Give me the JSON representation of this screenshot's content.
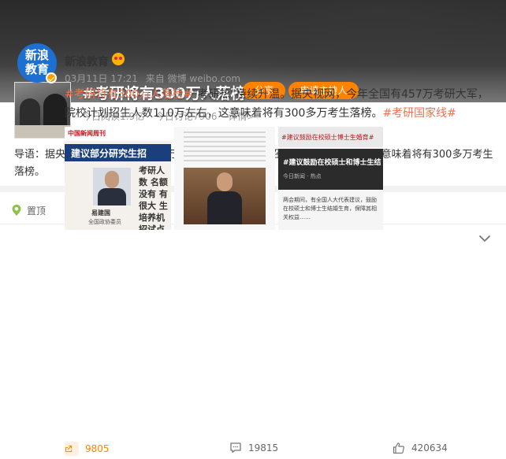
{
  "topic": {
    "title": "#考研将有300万人落榜#",
    "share_label": "分享",
    "host_label": "申请主持人",
    "reads": "今日阅读1.9亿",
    "discussions": "今日讨论7906",
    "details_label": "详情>",
    "intro": "导语：据央视网，今年全国有457万考研大军，院校计划招生人数110万左右，这意味着将有300多万考生落榜。"
  },
  "feed": {
    "pin_label": "置顶",
    "author": {
      "name": "新浪教育",
      "avatar_line1": "新浪",
      "avatar_line2": "教育"
    },
    "time": "03月11日 17:21",
    "source": "来自 微博 weibo.com",
    "text": {
      "hashtag1": "#考研将有300万人落榜#",
      "body": "\"考研热\"持续升温。据央视网，今年全国有457万考研大军，院校计划招生人数110万左右，这意味着将有300多万考生落榜。",
      "hashtag2": "#考研国家线#"
    },
    "images": {
      "img1": {
        "logo": "中国新闻周刊",
        "band": "建议部分研究生招",
        "name": "易建国",
        "role": "全国政协委员",
        "column": "考研人数 名额没有 有很大 生培养机 招试点 生计划"
      },
      "img2": {},
      "img3": {
        "top": "#建议鼓励在校硕士博士生婚育#",
        "dark": "#建议鼓励在校硕士和博士生结",
        "sub": "今日新闻 · 热点",
        "body": "两会期间，有全国人大代表建议，鼓励在校硕士和博士生结婚生育，保障其相关权益……"
      }
    },
    "actions": {
      "forward_count": "9805",
      "comment_count": "19815",
      "like_count": "420634"
    }
  },
  "colors": {
    "accent_orange": "#ff8200",
    "hashtag": "#eb7350",
    "avatar_blue": "#1d6fd1"
  }
}
